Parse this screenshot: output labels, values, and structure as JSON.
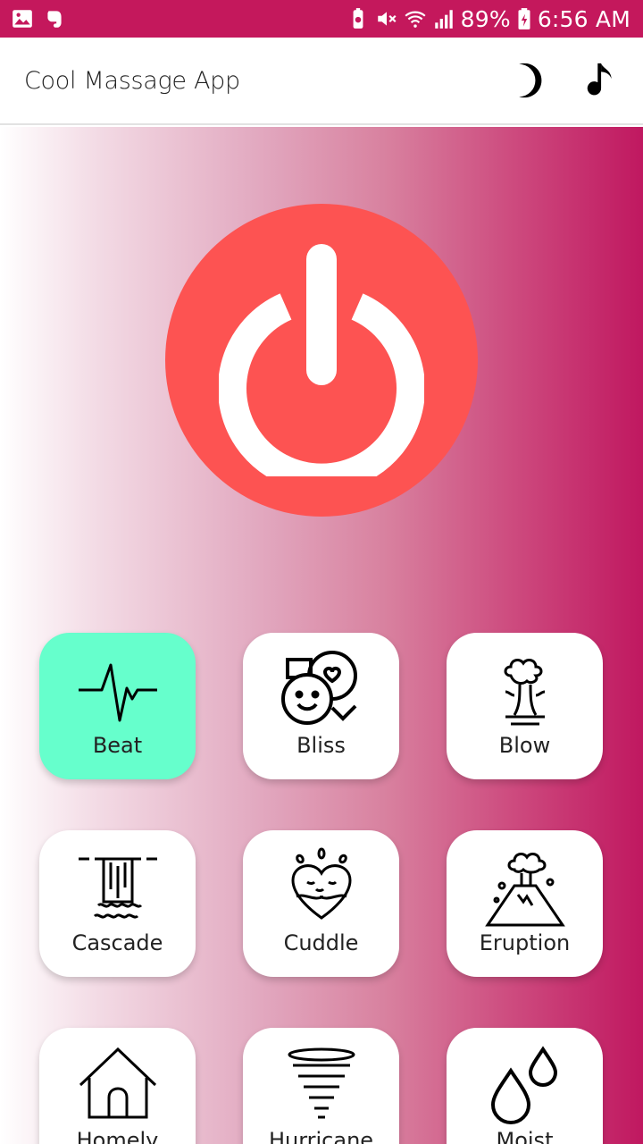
{
  "status_bar": {
    "battery": "89%",
    "time": "6:56 AM"
  },
  "app_bar": {
    "title": "Cool Massage App"
  },
  "colors": {
    "status_bar": "#c4185c",
    "power_button": "#fd5352",
    "active_tile": "#66ffcc",
    "gradient_end": "#c01860"
  },
  "power_button": {
    "icon": "power-icon",
    "state": "off"
  },
  "modes": [
    {
      "label": "Beat",
      "icon": "heartbeat-icon",
      "selected": true
    },
    {
      "label": "Bliss",
      "icon": "bliss-icon",
      "selected": false
    },
    {
      "label": "Blow",
      "icon": "geyser-icon",
      "selected": false
    },
    {
      "label": "Cascade",
      "icon": "waterfall-icon",
      "selected": false
    },
    {
      "label": "Cuddle",
      "icon": "hug-icon",
      "selected": false
    },
    {
      "label": "Eruption",
      "icon": "volcano-icon",
      "selected": false
    },
    {
      "label": "Homely",
      "icon": "house-icon",
      "selected": false
    },
    {
      "label": "Hurricane",
      "icon": "tornado-icon",
      "selected": false
    },
    {
      "label": "Moist",
      "icon": "drops-icon",
      "selected": false
    }
  ]
}
